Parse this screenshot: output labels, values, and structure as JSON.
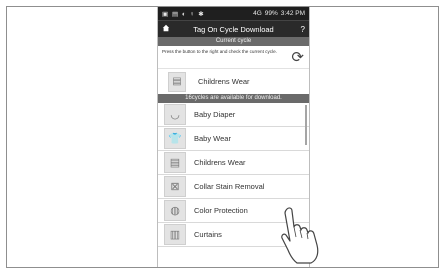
{
  "status_bar": {
    "left_icons": "▣ ▤ ◐ ♀ ✱",
    "network": "4G",
    "battery": "99%",
    "time": "3:42 PM"
  },
  "title_bar": {
    "home_icon": "home-icon",
    "title": "Tag On Cycle Download",
    "help_label": "?"
  },
  "current_cycle": {
    "header": "Current cycle",
    "instructions": "Press the button to the right and check the current cycle.",
    "refresh_icon": "refresh-icon",
    "cycle_name": "Childrens Wear",
    "cycle_icon": "childrens-wear-icon"
  },
  "available": {
    "header": "16cycles are available for download."
  },
  "cycles": [
    {
      "label": "Baby Diaper",
      "icon": "baby-diaper-icon",
      "glyph": "◡"
    },
    {
      "label": "Baby Wear",
      "icon": "baby-wear-icon",
      "glyph": "👕"
    },
    {
      "label": "Childrens Wear",
      "icon": "childrens-wear-icon",
      "glyph": "▤"
    },
    {
      "label": "Collar Stain Removal",
      "icon": "collar-stain-icon",
      "glyph": "⊠"
    },
    {
      "label": "Color Protection",
      "icon": "color-protection-icon",
      "glyph": "◍"
    },
    {
      "label": "Curtains",
      "icon": "curtains-icon",
      "glyph": "▥"
    }
  ]
}
